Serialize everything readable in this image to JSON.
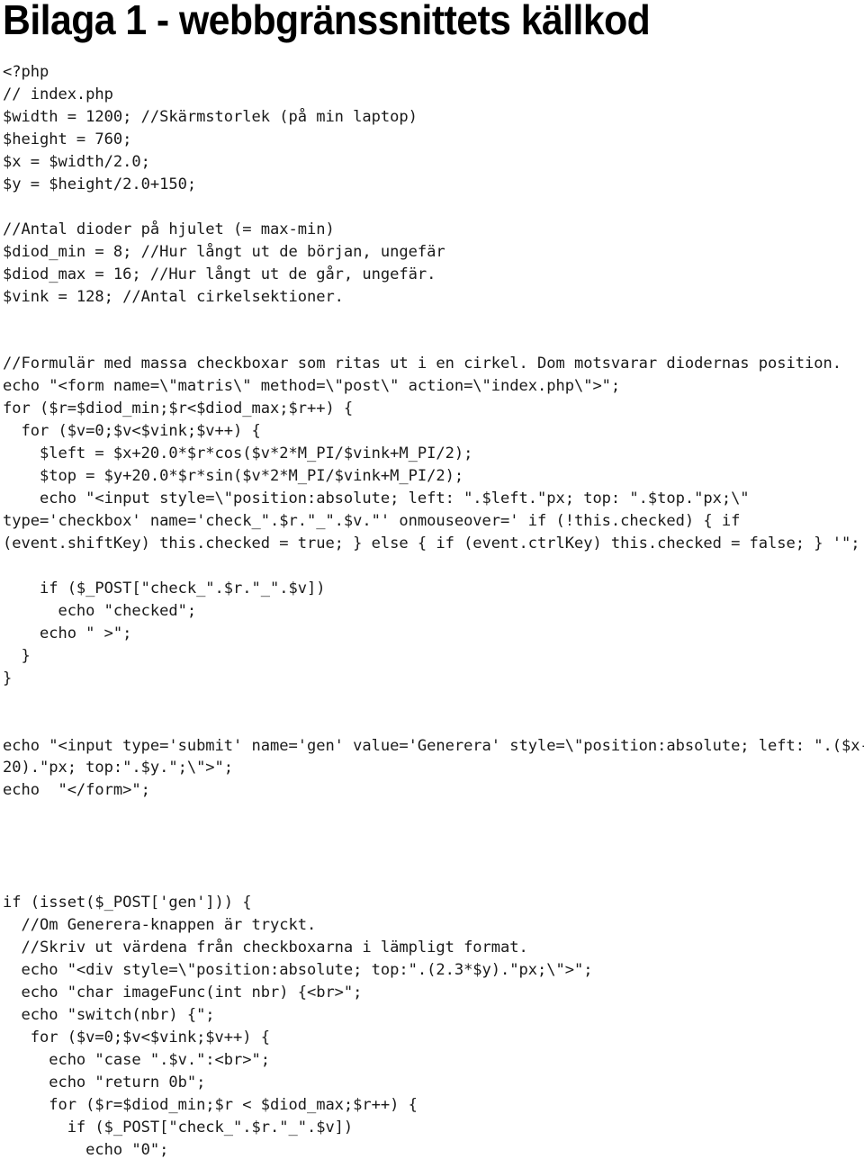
{
  "document": {
    "title": "Bilaga 1 - webbgränssnittets källkod",
    "code_lines": [
      "<?php",
      "// index.php",
      "$width = 1200; //Skärmstorlek (på min laptop)",
      "$height = 760;",
      "$x = $width/2.0;",
      "$y = $height/2.0+150;",
      "",
      "//Antal dioder på hjulet (= max-min)",
      "$diod_min = 8; //Hur långt ut de början, ungefär",
      "$diod_max = 16; //Hur långt ut de går, ungefär.",
      "$vink = 128; //Antal cirkelsektioner.",
      "",
      "",
      "//Formulär med massa checkboxar som ritas ut i en cirkel. Dom motsvarar diodernas position.",
      "echo \"<form name=\\\"matris\\\" method=\\\"post\\\" action=\\\"index.php\\\">\";",
      "for ($r=$diod_min;$r<$diod_max;$r++) {",
      "  for ($v=0;$v<$vink;$v++) {",
      "    $left = $x+20.0*$r*cos($v*2*M_PI/$vink+M_PI/2);",
      "    $top = $y+20.0*$r*sin($v*2*M_PI/$vink+M_PI/2);",
      "    echo \"<input style=\\\"position:absolute; left: \".$left.\"px; top: \".$top.\"px;\\\"",
      "type='checkbox' name='check_\".$r.\"_\".$v.\"' onmouseover=' if (!this.checked) { if",
      "(event.shiftKey) this.checked = true; } else { if (event.ctrlKey) this.checked = false; } '\";",
      "",
      "    if ($_POST[\"check_\".$r.\"_\".$v])",
      "      echo \"checked\";",
      "    echo \" >\";",
      "  }",
      "}",
      "",
      "",
      "echo \"<input type='submit' name='gen' value='Generera' style=\\\"position:absolute; left: \".($x-",
      "20).\"px; top:\".$y.\";\\\">\";",
      "echo  \"</form>\";",
      "",
      "",
      "",
      "",
      "if (isset($_POST['gen'])) {",
      "  //Om Generera-knappen är tryckt.",
      "  //Skriv ut värdena från checkboxarna i lämpligt format.",
      "  echo \"<div style=\\\"position:absolute; top:\".(2.3*$y).\"px;\\\">\";",
      "  echo \"char imageFunc(int nbr) {<br>\";",
      "  echo \"switch(nbr) {\";",
      "   for ($v=0;$v<$vink;$v++) {",
      "     echo \"case \".$v.\":<br>\";",
      "     echo \"return 0b\";",
      "     for ($r=$diod_min;$r < $diod_max;$r++) {",
      "       if ($_POST[\"check_\".$r.\"_\".$v])",
      "         echo \"0\";"
    ]
  }
}
